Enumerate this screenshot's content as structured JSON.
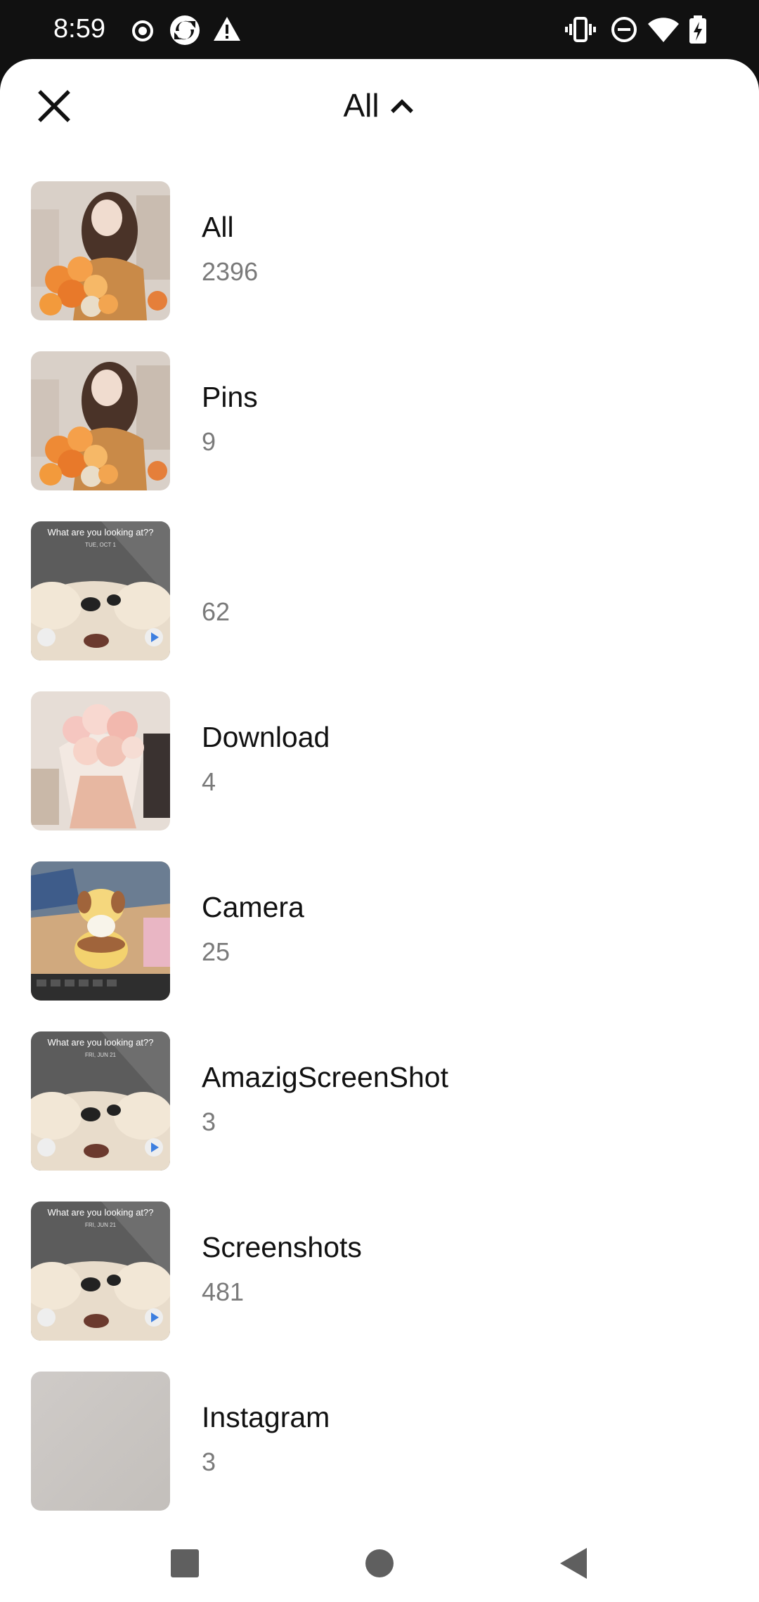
{
  "status_bar": {
    "time": "8:59",
    "left_icons": [
      "record-icon",
      "sync-app-icon",
      "warning-icon"
    ],
    "right_icons": [
      "vibrate-icon",
      "do-not-disturb-icon",
      "wifi-icon",
      "battery-charging-icon"
    ]
  },
  "header": {
    "close_icon": "close-icon",
    "title": "All",
    "chevron_icon": "chevron-up-icon"
  },
  "albums": [
    {
      "name": "All",
      "count": "2396",
      "thumb": "girl-flowers"
    },
    {
      "name": "Pins",
      "count": "9",
      "thumb": "girl-flowers"
    },
    {
      "name": "",
      "count": "62",
      "thumb": "lockscreen-cartoon",
      "thumb_text": "What are you looking at??",
      "thumb_date": "TUE, OCT 1"
    },
    {
      "name": "Download",
      "count": "4",
      "thumb": "pink-bouquet"
    },
    {
      "name": "Camera",
      "count": "25",
      "thumb": "toy-desk"
    },
    {
      "name": "AmazigScreenShot",
      "count": "3",
      "thumb": "lockscreen-cartoon",
      "thumb_text": "What are you looking at??",
      "thumb_date": "FRI, JUN 21"
    },
    {
      "name": "Screenshots",
      "count": "481",
      "thumb": "lockscreen-cartoon",
      "thumb_text": "What are you looking at??",
      "thumb_date": "FRI, JUN 21"
    },
    {
      "name": "Instagram",
      "count": "3",
      "thumb": "plain-gray"
    }
  ],
  "nav_bar": {
    "icons": [
      "recents-square-icon",
      "home-circle-icon",
      "back-triangle-icon"
    ]
  },
  "colors": {
    "status_bg": "#111111",
    "sheet_bg": "#ffffff",
    "text_primary": "#111111",
    "text_secondary": "#7a7a7a",
    "nav_icon": "#5f5f5f"
  }
}
